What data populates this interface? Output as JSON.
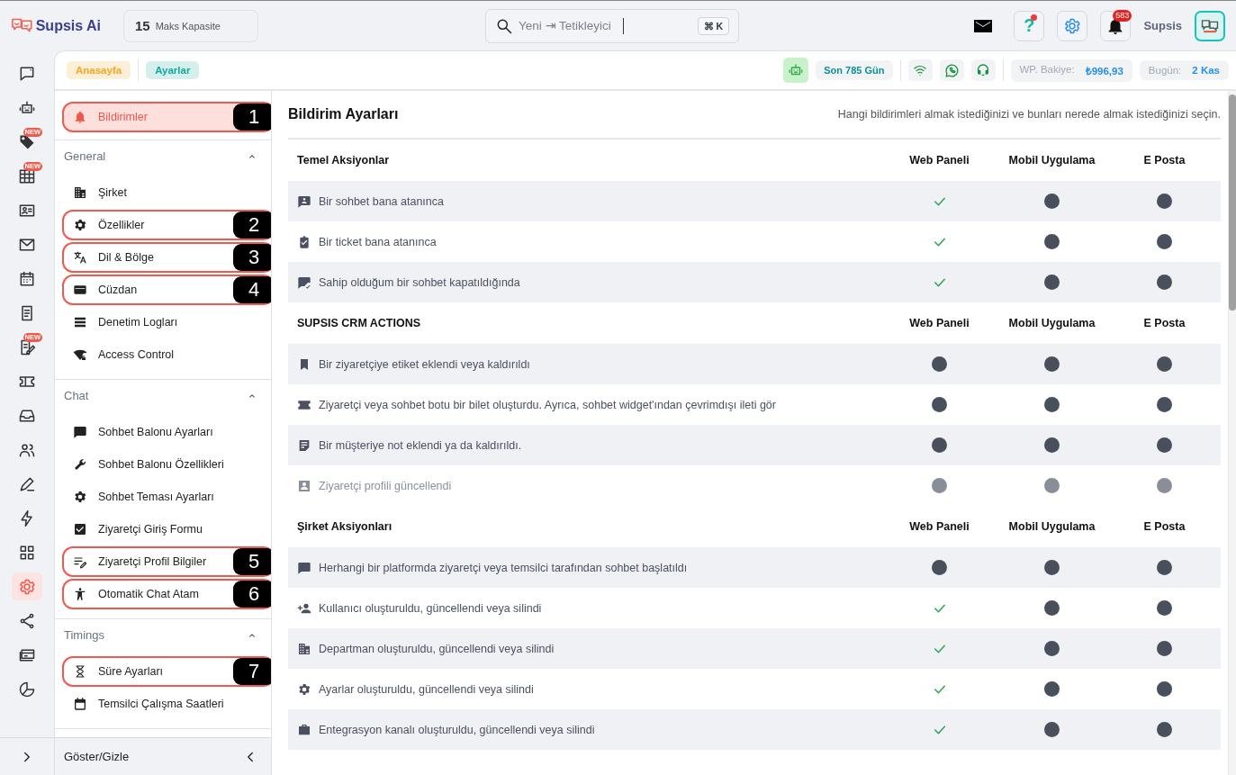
{
  "brand": {
    "name": "Supsis Ai"
  },
  "capacity": {
    "value": "15",
    "label": "Maks Kapasite"
  },
  "search": {
    "placeholder": "Yeni ⇥ Tetikleyici",
    "shortcut": "⌘ K"
  },
  "header": {
    "help_symbol": "?",
    "help_alert": true,
    "notification_count": "583",
    "user_name": "Supsis"
  },
  "rail": [
    {
      "selected": false
    },
    {
      "selected": false
    },
    {
      "selected": false,
      "badge": "NEW"
    },
    {
      "selected": false,
      "badge": "NEW"
    },
    {
      "selected": false
    },
    {
      "selected": false
    },
    {
      "selected": false
    },
    {
      "selected": false
    },
    {
      "selected": false,
      "badge": "NEW"
    },
    {
      "selected": false
    },
    {
      "selected": false
    },
    {
      "selected": false
    },
    {
      "selected": false
    },
    {
      "selected": false
    },
    {
      "selected": false
    },
    {
      "selected": true
    },
    {
      "selected": false
    },
    {
      "selected": false
    },
    {
      "selected": false
    }
  ],
  "breadcrumbs": [
    {
      "label": "Anasayfa",
      "color": "#f5a623"
    },
    {
      "label": "Ayarlar",
      "color": "#14a89c"
    }
  ],
  "status": {
    "days": "Son 785 Gün",
    "balance_label": "WP. Bakiye:",
    "balance": "₺996,93",
    "date_label": "Bugün:",
    "date": "2 Kas"
  },
  "settings_nav": {
    "top_items": [
      {
        "label": "Bildirimler",
        "selected": true,
        "callout": "1"
      }
    ],
    "groups": [
      {
        "title": "General",
        "expanded": true,
        "items": [
          {
            "label": "Şirket",
            "selected": false
          },
          {
            "label": "Özellikler",
            "selected": false,
            "callout": "2"
          },
          {
            "label": "Dil & Bölge",
            "selected": false,
            "callout": "3"
          },
          {
            "label": "Cüzdan",
            "selected": false,
            "callout": "4"
          },
          {
            "label": "Denetim Logları",
            "selected": false
          },
          {
            "label": "Access Control",
            "selected": false
          }
        ]
      },
      {
        "title": "Chat",
        "expanded": true,
        "items": [
          {
            "label": "Sohbet Balonu Ayarları",
            "selected": false
          },
          {
            "label": "Sohbet Balonu Özellikleri",
            "selected": false
          },
          {
            "label": "Sohbet Teması Ayarları",
            "selected": false
          },
          {
            "label": "Ziyaretçi Giriş Formu",
            "selected": false
          },
          {
            "label": "Ziyaretçi Profil Bilgiler",
            "selected": false,
            "callout": "5"
          },
          {
            "label": "Otomatik Chat Atam",
            "selected": false,
            "callout": "6"
          }
        ]
      },
      {
        "title": "Timings",
        "expanded": true,
        "items": [
          {
            "label": "Süre Ayarları",
            "selected": false,
            "callout": "7"
          },
          {
            "label": "Temsilci Çalışma Saatleri",
            "selected": false
          }
        ]
      }
    ],
    "footer": "Göster/Gizle"
  },
  "notifications": {
    "title": "Bildirim Ayarları",
    "subtitle": "Hangi bildirimleri almak istediğinizi ve bunları nerede almak istediğinizi seçin.",
    "sections": [
      {
        "title": "Temel Aksiyonlar",
        "columns": [
          "Web Paneli",
          "Mobil Uygulama",
          "E Posta"
        ],
        "rows": [
          {
            "label": "Bir sohbet bana atanınca",
            "disabled": false,
            "web_panel": true,
            "mobile_app": false,
            "email": false
          },
          {
            "label": "Bir ticket bana atanınca",
            "disabled": false,
            "web_panel": true,
            "mobile_app": false,
            "email": false
          },
          {
            "label": "Sahip olduğum bir sohbet kapatıldığında",
            "disabled": false,
            "web_panel": true,
            "mobile_app": false,
            "email": false
          }
        ]
      },
      {
        "title": "SUPSIS CRM ACTIONS",
        "columns": [
          "Web Paneli",
          "Mobil Uygulama",
          "E Posta"
        ],
        "rows": [
          {
            "label": "Bir ziyaretçiye etiket eklendi veya kaldırıldı",
            "disabled": false,
            "web_panel": false,
            "mobile_app": false,
            "email": false
          },
          {
            "label": "Ziyaretçi veya sohbet botu bir bilet oluşturdu. Ayrıca, sohbet widget'ından çevrimdışı ileti gör",
            "disabled": false,
            "web_panel": false,
            "mobile_app": false,
            "email": false
          },
          {
            "label": "Bir müşteriye not eklendi ya da kaldırıldı.",
            "disabled": false,
            "web_panel": false,
            "mobile_app": false,
            "email": false
          },
          {
            "label": "Ziyaretçi profili güncellendi",
            "disabled": true,
            "web_panel": false,
            "mobile_app": false,
            "email": false
          }
        ]
      },
      {
        "title": "Şirket Aksiyonları",
        "columns": [
          "Web Paneli",
          "Mobil Uygulama",
          "E Posta"
        ],
        "rows": [
          {
            "label": "Herhangi bir platformda ziyaretçi veya temsilci tarafından sohbet başlatıldı",
            "disabled": false,
            "web_panel": false,
            "mobile_app": false,
            "email": false
          },
          {
            "label": "Kullanıcı oluşturuldu, güncellendi veya silindi",
            "disabled": false,
            "web_panel": true,
            "mobile_app": false,
            "email": false
          },
          {
            "label": "Departman oluşturuldu, güncellendi veya silindi",
            "disabled": false,
            "web_panel": true,
            "mobile_app": false,
            "email": false
          },
          {
            "label": "Ayarlar oluşturuldu, güncellendi veya silindi",
            "disabled": false,
            "web_panel": true,
            "mobile_app": false,
            "email": false
          },
          {
            "label": "Entegrasyon kanalı oluşturuldu, güncellendi veya silindi",
            "disabled": false,
            "web_panel": true,
            "mobile_app": false,
            "email": false
          }
        ]
      }
    ]
  }
}
